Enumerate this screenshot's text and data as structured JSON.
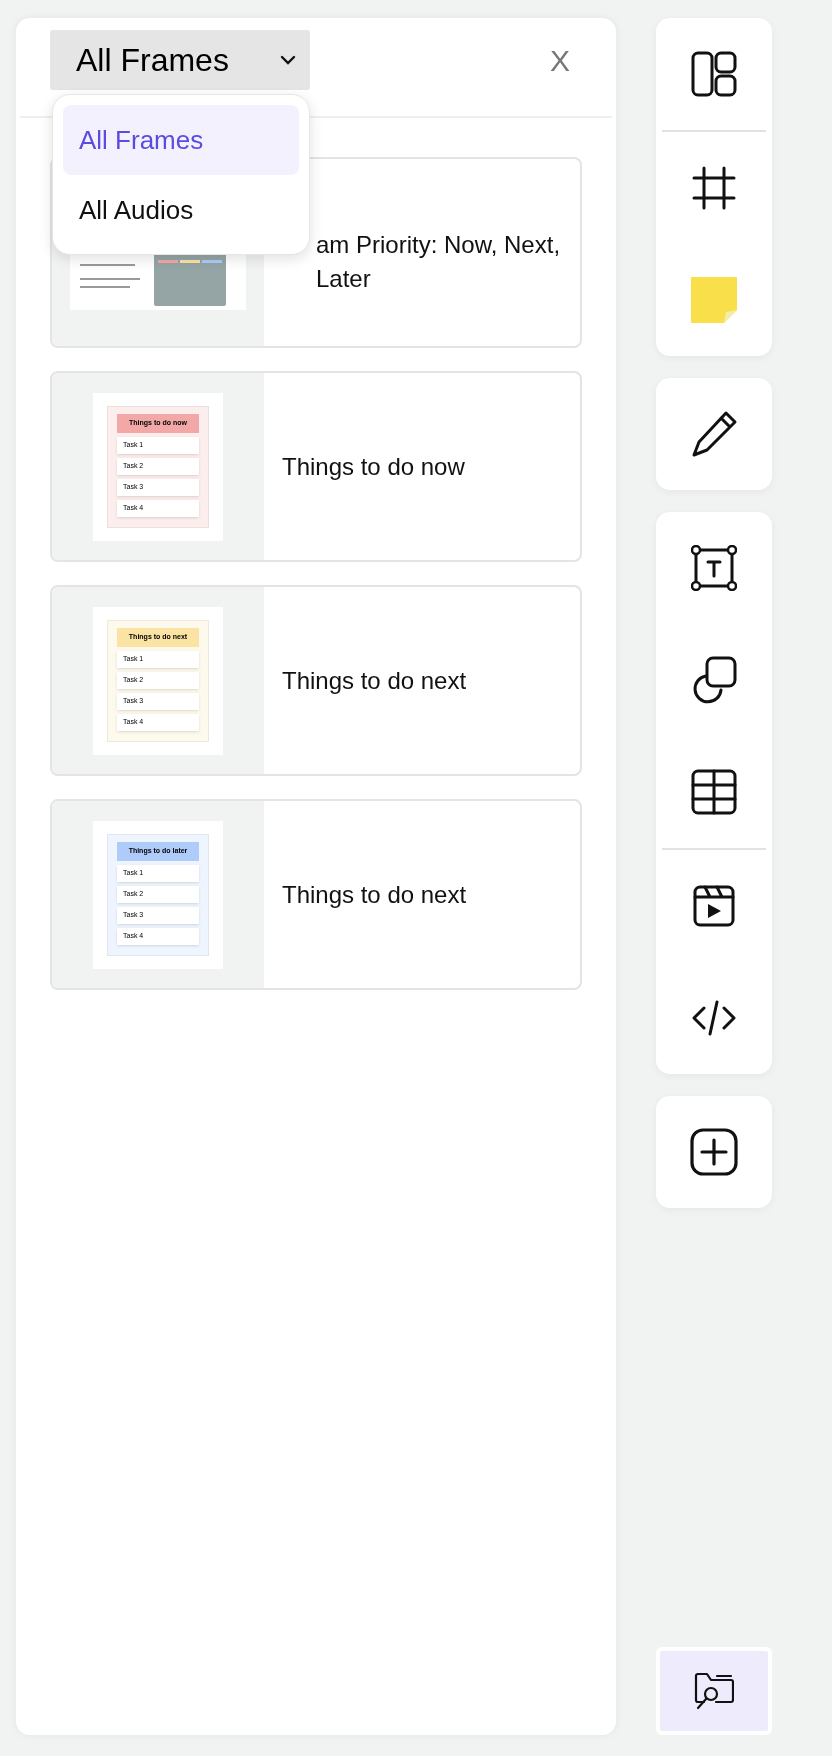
{
  "filter": {
    "label": "All Frames",
    "expanded": true,
    "options": [
      {
        "label": "All Frames",
        "selected": true
      },
      {
        "label": "All Audios",
        "selected": false
      }
    ]
  },
  "close": {
    "label": "X"
  },
  "frames": [
    {
      "title": "am Priority: Now, Next, Later",
      "thumbnail": {
        "kind": "document"
      }
    },
    {
      "title": "Things to do now",
      "thumbnail": {
        "kind": "list",
        "heading": "Things to do now",
        "color": "#f2a8a6",
        "tasks": [
          "Task 1",
          "Task 2",
          "Task 3",
          "Task 4"
        ]
      }
    },
    {
      "title": "Things to do next",
      "thumbnail": {
        "kind": "list",
        "heading": "Things to do next",
        "color": "#fbe3a4",
        "tasks": [
          "Task 1",
          "Task 2",
          "Task 3",
          "Task 4"
        ]
      }
    },
    {
      "title": "Things to do next",
      "thumbnail": {
        "kind": "list",
        "heading": "Things to do later",
        "color": "#aecbfa",
        "tasks": [
          "Task 1",
          "Task 2",
          "Task 3",
          "Task 4"
        ]
      }
    }
  ],
  "toolbar": [
    [
      {
        "kind": "layout"
      },
      {
        "divider": true,
        "kind": "frame"
      },
      {
        "kind": "sticky-note"
      }
    ],
    [
      {
        "kind": "pencil"
      }
    ],
    [
      {
        "kind": "text-box"
      },
      {
        "kind": "shapes"
      },
      {
        "kind": "table"
      },
      {
        "divider": true,
        "kind": "video"
      },
      {
        "kind": "code"
      }
    ],
    [
      {
        "kind": "add"
      }
    ]
  ],
  "bottom_button": {
    "kind": "folder-search",
    "selected": true
  }
}
